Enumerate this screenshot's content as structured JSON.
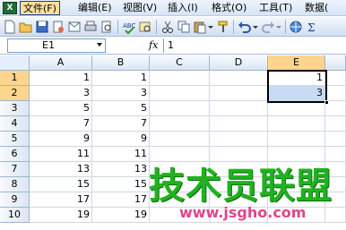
{
  "app_icon": "excel-logo",
  "menu": [
    "文件(F)",
    "编辑(E)",
    "视图(V)",
    "插入(I)",
    "格式(O)",
    "工具(T)",
    "数据("
  ],
  "name_box": "E1",
  "fx": "fx",
  "formula": "1",
  "columns": [
    "A",
    "B",
    "C",
    "D",
    "E"
  ],
  "rows": [
    {
      "num": "1",
      "A": "1",
      "B": "1",
      "E": "1"
    },
    {
      "num": "2",
      "A": "3",
      "B": "3",
      "E": "3"
    },
    {
      "num": "3",
      "A": "5",
      "B": "5",
      "E": ""
    },
    {
      "num": "4",
      "A": "7",
      "B": "7",
      "E": ""
    },
    {
      "num": "5",
      "A": "9",
      "B": "9",
      "E": ""
    },
    {
      "num": "6",
      "A": "11",
      "B": "11",
      "E": ""
    },
    {
      "num": "7",
      "A": "13",
      "B": "13",
      "E": ""
    },
    {
      "num": "8",
      "A": "15",
      "B": "15",
      "E": ""
    },
    {
      "num": "9",
      "A": "17",
      "B": "17",
      "E": ""
    },
    {
      "num": "10",
      "A": "19",
      "B": "19",
      "E": ""
    }
  ],
  "toolbar_icons": [
    "new-icon",
    "open-icon",
    "save-icon",
    "permission-icon",
    "email-icon",
    "print-icon",
    "print-preview-icon",
    "spelling-icon",
    "research-icon",
    "cut-icon",
    "copy-icon",
    "paste-icon",
    "format-painter-icon",
    "undo-icon",
    "redo-icon"
  ],
  "watermark": {
    "title": "技术员联盟",
    "url": "www.jsgho.com"
  },
  "colors": {
    "selected_header": "#ffd58d",
    "selection_fill": "#c7dcf4",
    "watermark_green": "#20b220",
    "watermark_pink": "#e0458c"
  }
}
